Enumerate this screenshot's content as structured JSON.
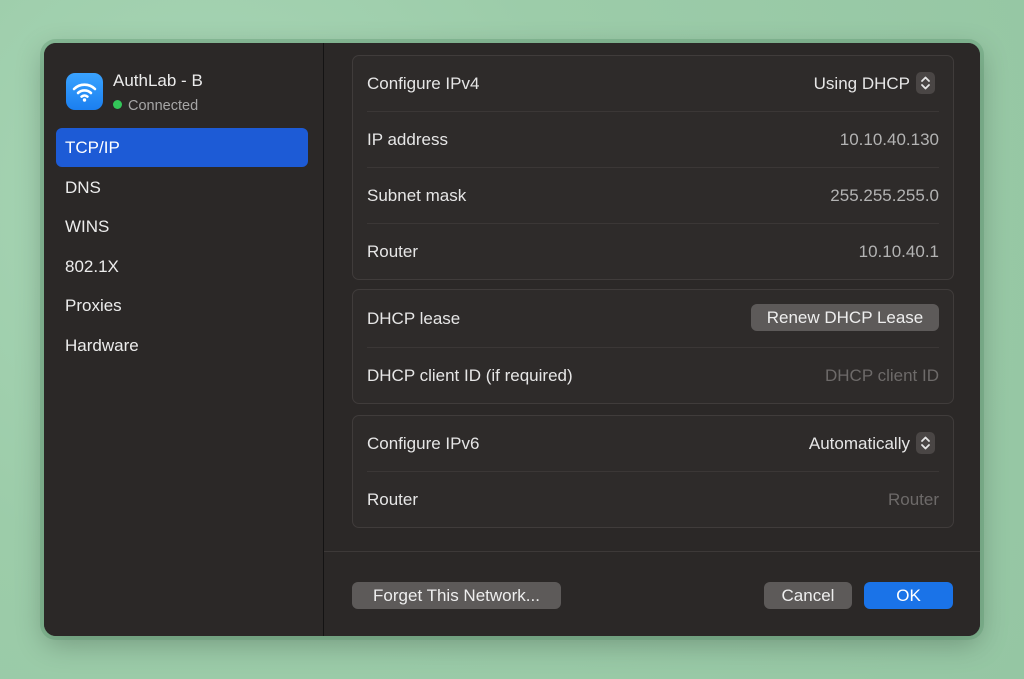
{
  "network": {
    "name": "AuthLab - B",
    "status": "Connected",
    "icon": "wifi-icon",
    "status_color": "#33c759"
  },
  "sidebar": {
    "items": [
      {
        "label": "TCP/IP",
        "active": true
      },
      {
        "label": "DNS"
      },
      {
        "label": "WINS"
      },
      {
        "label": "802.1X"
      },
      {
        "label": "Proxies"
      },
      {
        "label": "Hardware"
      }
    ]
  },
  "ipv4": {
    "configure_label": "Configure IPv4",
    "configure_value": "Using DHCP",
    "ip_label": "IP address",
    "ip_value": "10.10.40.130",
    "subnet_label": "Subnet mask",
    "subnet_value": "255.255.255.0",
    "router_label": "Router",
    "router_value": "10.10.40.1"
  },
  "dhcp": {
    "lease_label": "DHCP lease",
    "renew_button": "Renew DHCP Lease",
    "client_id_label": "DHCP client ID (if required)",
    "client_id_placeholder": "DHCP client ID"
  },
  "ipv6": {
    "configure_label": "Configure IPv6",
    "configure_value": "Automatically",
    "router_label": "Router",
    "router_placeholder": "Router"
  },
  "footer": {
    "forget_button": "Forget This Network...",
    "cancel_button": "Cancel",
    "ok_button": "OK"
  },
  "colors": {
    "accent": "#1a73e8",
    "selection": "#1d5bd6",
    "window_bg": "#2b2827"
  }
}
